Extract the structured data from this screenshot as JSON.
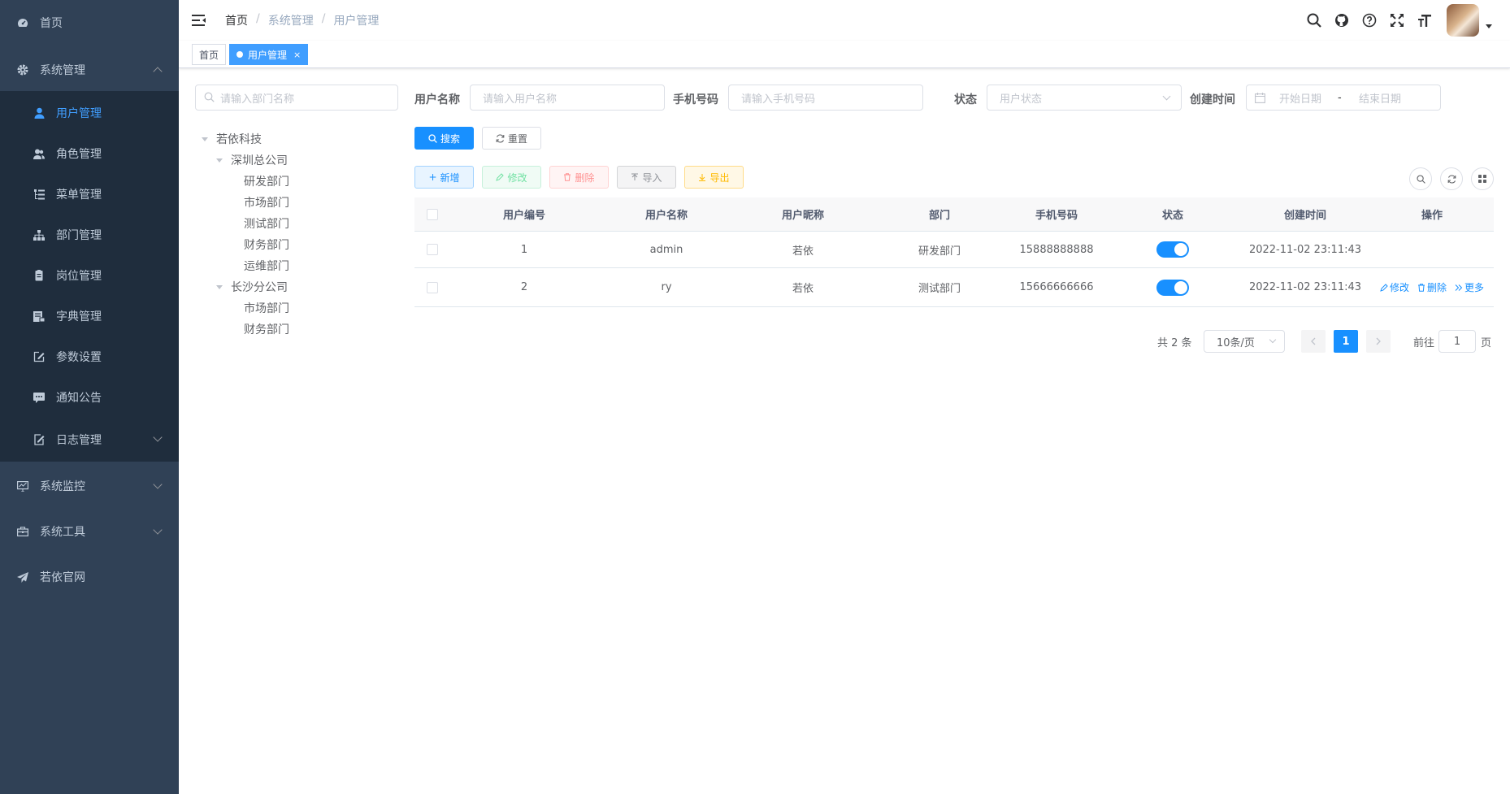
{
  "sidebar": {
    "items": [
      {
        "label": "首页",
        "icon": "dashboard-icon"
      },
      {
        "label": "系统管理",
        "icon": "gear-icon",
        "expanded": true
      },
      {
        "label": "系统监控",
        "icon": "monitor-icon"
      },
      {
        "label": "系统工具",
        "icon": "toolbox-icon"
      },
      {
        "label": "若依官网",
        "icon": "send-icon"
      }
    ],
    "sub_items": [
      {
        "label": "用户管理",
        "icon": "user-icon",
        "active": true
      },
      {
        "label": "角色管理",
        "icon": "peoples-icon"
      },
      {
        "label": "菜单管理",
        "icon": "tree-table-icon"
      },
      {
        "label": "部门管理",
        "icon": "tree-icon"
      },
      {
        "label": "岗位管理",
        "icon": "post-icon"
      },
      {
        "label": "字典管理",
        "icon": "dict-icon"
      },
      {
        "label": "参数设置",
        "icon": "edit-icon"
      },
      {
        "label": "通知公告",
        "icon": "message-icon"
      },
      {
        "label": "日志管理",
        "icon": "log-icon"
      }
    ]
  },
  "navbar": {
    "breadcrumb": [
      "首页",
      "系统管理",
      "用户管理"
    ]
  },
  "tags": {
    "home": "首页",
    "current": "用户管理",
    "close": "×"
  },
  "dept_tree": {
    "search_placeholder": "请输入部门名称",
    "nodes": [
      {
        "label": "若依科技"
      },
      {
        "label": "深圳总公司"
      },
      {
        "label": "研发部门"
      },
      {
        "label": "市场部门"
      },
      {
        "label": "测试部门"
      },
      {
        "label": "财务部门"
      },
      {
        "label": "运维部门"
      },
      {
        "label": "长沙分公司"
      },
      {
        "label": "市场部门"
      },
      {
        "label": "财务部门"
      }
    ]
  },
  "filters": {
    "username_label": "用户名称",
    "username_placeholder": "请输入用户名称",
    "phone_label": "手机号码",
    "phone_placeholder": "请输入手机号码",
    "status_label": "状态",
    "status_placeholder": "用户状态",
    "date_label": "创建时间",
    "date_start": "开始日期",
    "date_sep": "-",
    "date_end": "结束日期",
    "search_btn": "搜索",
    "reset_btn": "重置"
  },
  "toolbar": {
    "add": "新增",
    "edit": "修改",
    "delete": "删除",
    "import": "导入",
    "export": "导出"
  },
  "table": {
    "headers": [
      "用户编号",
      "用户名称",
      "用户昵称",
      "部门",
      "手机号码",
      "状态",
      "创建时间",
      "操作"
    ],
    "rows": [
      {
        "id": "1",
        "username": "admin",
        "nickname": "若依",
        "dept": "研发部门",
        "phone": "15888888888",
        "status": true,
        "created": "2022-11-02 23:11:43",
        "ops": []
      },
      {
        "id": "2",
        "username": "ry",
        "nickname": "若依",
        "dept": "测试部门",
        "phone": "15666666666",
        "status": true,
        "created": "2022-11-02 23:11:43",
        "ops": [
          "修改",
          "删除",
          "更多"
        ]
      }
    ]
  },
  "pagination": {
    "total": "共 2 条",
    "page_size": "10条/页",
    "current": "1",
    "goto_label": "前往",
    "goto_value": "1",
    "page_suffix": "页"
  },
  "colors": {
    "sidebar": "#304156",
    "submenu": "#1f2d3d",
    "primary": "#1890ff",
    "active_text": "#409eff"
  }
}
